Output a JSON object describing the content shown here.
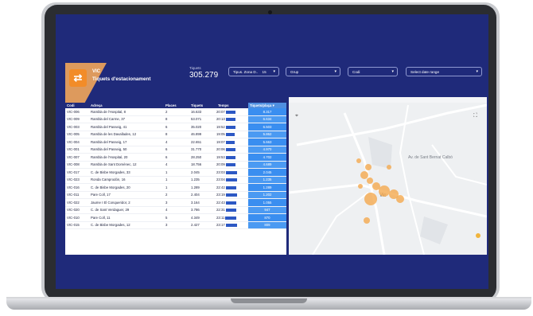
{
  "report": {
    "logo_glyph": "⇄",
    "city": "VIC",
    "title": "Tiquets d'estacionament",
    "kpi_label": "Tiquets",
    "kpi_value": "305.279"
  },
  "filters": [
    {
      "label": "Tipus. Zona D..",
      "extra": "15"
    },
    {
      "label": "Grup"
    },
    {
      "label": "Codi"
    },
    {
      "label": "Select date range"
    }
  ],
  "table": {
    "headers": [
      "Codi",
      "Adreça",
      "Places",
      "Tiquets",
      "Temps",
      "Tiquets/plaça ▾"
    ],
    "rows": [
      {
        "codi": "VIC-006",
        "adreca": "Rambla de l'Hospital, 8",
        "places": "2",
        "tiquets": "16.633",
        "temps": "20:07",
        "ratio": "8.317",
        "bar": 0.9
      },
      {
        "codi": "VIC-009",
        "adreca": "Rambla del Carme, 37",
        "places": "8",
        "tiquets": "53.071",
        "temps": "20:13",
        "ratio": "6.634",
        "bar": 0.9
      },
      {
        "codi": "VIC-003",
        "adreca": "Rambla del Passeig, 41",
        "places": "6",
        "tiquets": "35.020",
        "temps": "19:52",
        "ratio": "6.503",
        "bar": 0.85
      },
      {
        "codi": "VIC-005",
        "adreca": "Rambla de les Davallades, 12",
        "places": "8",
        "tiquets": "46.899",
        "temps": "19:05",
        "ratio": "5.862",
        "bar": 0.8
      },
      {
        "codi": "VIC-004",
        "adreca": "Rambla del Passeig, 17",
        "places": "4",
        "tiquets": "22.651",
        "temps": "19:07",
        "ratio": "5.663",
        "bar": 0.8
      },
      {
        "codi": "VIC-001",
        "adreca": "Rambla del Passeig, 50",
        "places": "6",
        "tiquets": "31.770",
        "temps": "20:06",
        "ratio": "4.970",
        "bar": 0.9
      },
      {
        "codi": "VIC-007",
        "adreca": "Rambla de l'Hospital, 20",
        "places": "6",
        "tiquets": "28.250",
        "temps": "19:53",
        "ratio": "4.702",
        "bar": 0.85
      },
      {
        "codi": "VIC-008",
        "adreca": "Rambla de Sant Domènec, 12",
        "places": "4",
        "tiquets": "18.756",
        "temps": "20:09",
        "ratio": "4.689",
        "bar": 0.9
      },
      {
        "codi": "VIC-017",
        "adreca": "C. de Bisbe Morgades, 33",
        "places": "1",
        "tiquets": "2.045",
        "temps": "23:03",
        "ratio": "2.045",
        "bar": 1.0
      },
      {
        "codi": "VIC-023",
        "adreca": "Ronda Camprodón, 16",
        "places": "1",
        "tiquets": "1.235",
        "temps": "23:04",
        "ratio": "1.235",
        "bar": 1.0
      },
      {
        "codi": "VIC-016",
        "adreca": "C. de Bisbe Morgades, 20",
        "places": "1",
        "tiquets": "1.289",
        "temps": "22:42",
        "ratio": "1.289",
        "bar": 0.95
      },
      {
        "codi": "VIC-011",
        "adreca": "Pare Coll, 17",
        "places": "2",
        "tiquets": "2.404",
        "temps": "23:19",
        "ratio": "1.202",
        "bar": 1.0
      },
      {
        "codi": "VIC-022",
        "adreca": "Jaume I El Conqueridor, 2",
        "places": "3",
        "tiquets": "3.164",
        "temps": "22:43",
        "ratio": "1.055",
        "bar": 0.95
      },
      {
        "codi": "VIC-020",
        "adreca": "C. de Sant Verdaguer, 29",
        "places": "4",
        "tiquets": "3.786",
        "temps": "22:31",
        "ratio": "947",
        "bar": 0.95
      },
      {
        "codi": "VIC-010",
        "adreca": "Pare Coll, 11",
        "places": "5",
        "tiquets": "4.349",
        "temps": "23:11",
        "ratio": "870",
        "bar": 1.0
      },
      {
        "codi": "VIC-015",
        "adreca": "C. de Bisbe Morgades, 12",
        "places": "3",
        "tiquets": "2.427",
        "temps": "23:17",
        "ratio": "809",
        "bar": 1.0
      }
    ]
  },
  "map": {
    "streets": [
      "Av. de Sant Bernat Calbó",
      "Vic"
    ],
    "bubble_color": "#f4a94e"
  }
}
